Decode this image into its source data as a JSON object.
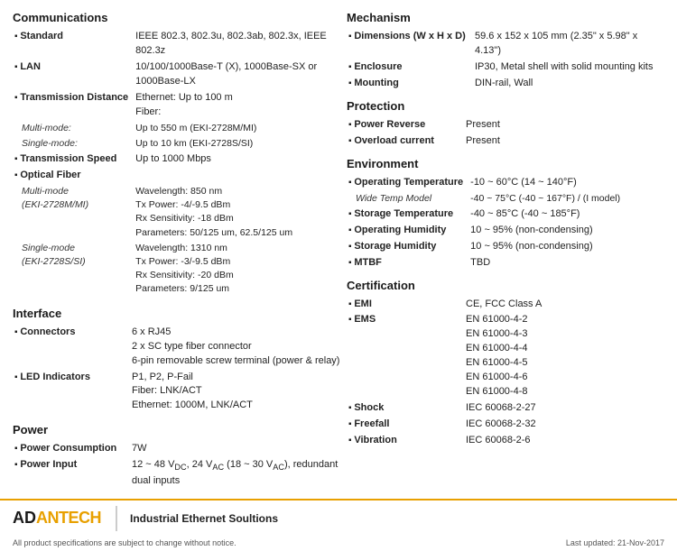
{
  "left": {
    "sections": [
      {
        "title": "Communications",
        "rows": [
          {
            "type": "bullet",
            "label": "Standard",
            "value": "IEEE 802.3, 802.3u, 802.3ab, 802.3x, IEEE 802.3z"
          },
          {
            "type": "bullet",
            "label": "LAN",
            "value": "10/100/1000Base-T (X), 1000Base-SX or 1000Base-LX"
          },
          {
            "type": "bullet",
            "label": "Transmission Distance",
            "value": "Ethernet: Up to 100 m\nFiber:"
          },
          {
            "type": "sub",
            "label": "Multi-mode:",
            "value": "Up to 550 m (EKI-2728M/MI)"
          },
          {
            "type": "sub",
            "label": "Single-mode:",
            "value": "Up to 10 km (EKI-2728S/SI)"
          },
          {
            "type": "bullet",
            "label": "Transmission Speed",
            "value": "Up to 1000 Mbps"
          },
          {
            "type": "bullet",
            "label": "Optical Fiber",
            "value": ""
          },
          {
            "type": "sub-model",
            "label": "Multi-mode\n(EKI-2728M/MI)",
            "value": "Wavelength: 850 nm\nTx Power: -4/-9.5 dBm\nRx Sensitivity: -18 dBm\nParameters: 50/125 um, 62.5/125 um"
          },
          {
            "type": "sub-model",
            "label": "Single-mode\n(EKI-2728S/SI)",
            "value": "Wavelength: 1310 nm\nTx Power: -3/-9.5 dBm\nRx Sensitivity: -20 dBm\nParameters: 9/125 um"
          }
        ]
      },
      {
        "title": "Interface",
        "rows": [
          {
            "type": "bullet",
            "label": "Connectors",
            "value": "6 x RJ45\n2 x SC type fiber connector\n6-pin removable screw terminal (power & relay)"
          },
          {
            "type": "bullet",
            "label": "LED Indicators",
            "value": "P1, P2, P-Fail\nFiber: LNK/ACT\nEthernet: 1000M, LNK/ACT"
          }
        ]
      },
      {
        "title": "Power",
        "rows": [
          {
            "type": "bullet",
            "label": "Power Consumption",
            "value": "7W"
          },
          {
            "type": "bullet",
            "label": "Power Input",
            "value": "12 ~ 48 VDC, 24 VAC (18 ~ 30 VAC), redundant dual inputs"
          }
        ]
      }
    ]
  },
  "right": {
    "sections": [
      {
        "title": "Mechanism",
        "rows": [
          {
            "type": "bullet",
            "label": "Dimensions (W x H x D)",
            "value": "59.6 x 152 x 105 mm (2.35\" x 5.98\" x 4.13\")"
          },
          {
            "type": "bullet",
            "label": "Enclosure",
            "value": "IP30, Metal shell with solid mounting kits"
          },
          {
            "type": "bullet",
            "label": "Mounting",
            "value": "DIN-rail, Wall"
          }
        ]
      },
      {
        "title": "Protection",
        "rows": [
          {
            "type": "bullet",
            "label": "Power Reverse",
            "value": "Present"
          },
          {
            "type": "bullet",
            "label": "Overload current",
            "value": "Present"
          }
        ]
      },
      {
        "title": "Environment",
        "rows": [
          {
            "type": "bullet",
            "label": "Operating Temperature",
            "value": "-10 ~ 60°C (14 ~ 140°F)"
          },
          {
            "type": "sub",
            "label": "Wide Temp Model",
            "value": "-40 ~ 75°C (-40 ~ 167°F) / (I model)"
          },
          {
            "type": "bullet",
            "label": "Storage Temperature",
            "value": "-40 ~ 85°C (-40 ~ 185°F)"
          },
          {
            "type": "bullet",
            "label": "Operating Humidity",
            "value": "10 ~ 95% (non-condensing)"
          },
          {
            "type": "bullet",
            "label": "Storage Humidity",
            "value": "10 ~ 95% (non-condensing)"
          },
          {
            "type": "bullet",
            "label": "MTBF",
            "value": "TBD"
          }
        ]
      },
      {
        "title": "Certification",
        "rows": [
          {
            "type": "bullet",
            "label": "EMI",
            "value": "CE, FCC Class A"
          },
          {
            "type": "bullet",
            "label": "EMS",
            "value": "EN 61000-4-2\nEN 61000-4-3\nEN 61000-4-4\nEN 61000-4-5\nEN 61000-4-6\nEN 61000-4-8"
          },
          {
            "type": "bullet",
            "label": "Shock",
            "value": "IEC 60068-2-27"
          },
          {
            "type": "bullet",
            "label": "Freefall",
            "value": "IEC 60068-2-32"
          },
          {
            "type": "bullet",
            "label": "Vibration",
            "value": "IEC 60068-2-6"
          }
        ]
      }
    ]
  },
  "footer": {
    "logo_prefix": "AD",
    "logo_brand": "ANTECH",
    "tagline": "Industrial Ethernet Soultions",
    "disclaimer": "All product specifications are subject to change without notice.",
    "updated": "Last updated: 21-Nov-2017"
  }
}
